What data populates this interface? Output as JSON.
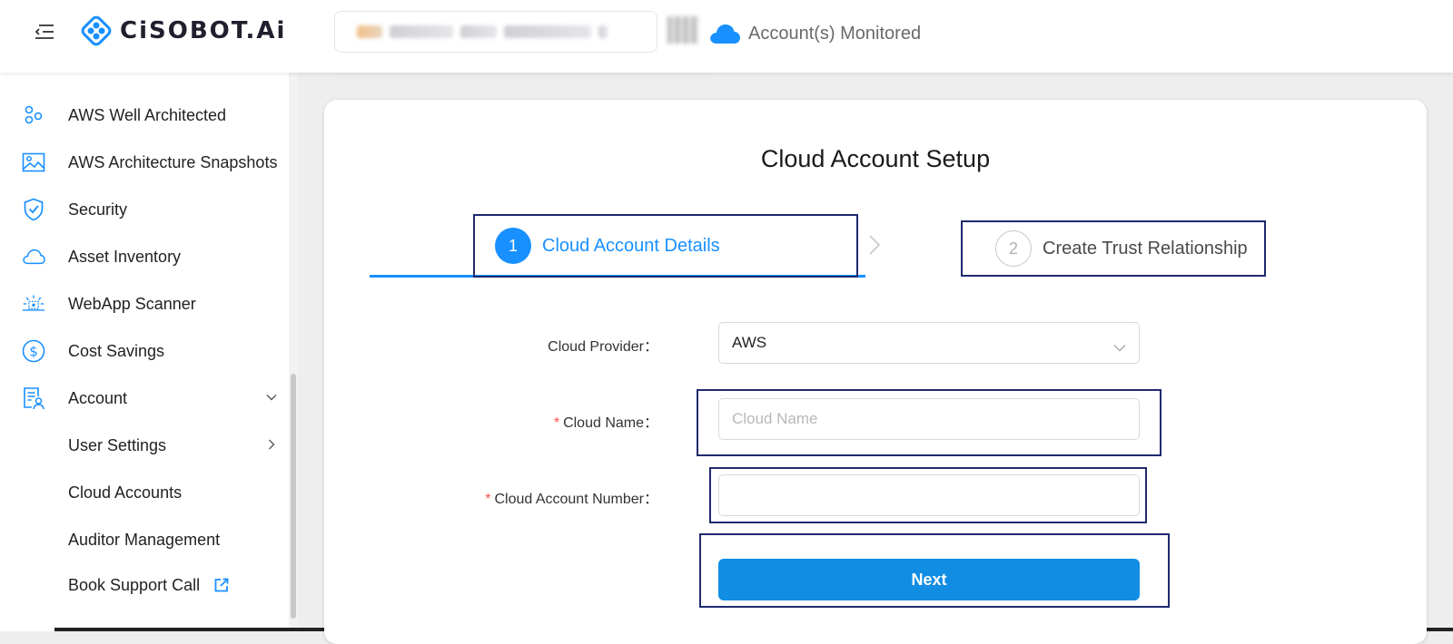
{
  "header": {
    "logo_text": "CiSOBOT.Ai",
    "monitored_label": "Account(s) Monitored"
  },
  "sidebar": {
    "items": [
      {
        "label": "AWS Well Architected",
        "icon": "aws-well-architected-icon"
      },
      {
        "label": "AWS Architecture Snapshots",
        "icon": "image-icon"
      },
      {
        "label": "Security",
        "icon": "shield-check-icon"
      },
      {
        "label": "Asset Inventory",
        "icon": "cloud-icon"
      },
      {
        "label": "WebApp Scanner",
        "icon": "scanner-icon"
      },
      {
        "label": "Cost Savings",
        "icon": "dollar-icon"
      },
      {
        "label": "Account",
        "icon": "account-icon"
      },
      {
        "label": "User Settings"
      },
      {
        "label": "Cloud Accounts"
      },
      {
        "label": "Auditor Management"
      },
      {
        "label": "Book Support Call",
        "icon": "external-link-icon"
      }
    ]
  },
  "main": {
    "title": "Cloud Account Setup",
    "steps": [
      {
        "number": "1",
        "label": "Cloud Account Details",
        "state": "active"
      },
      {
        "number": "2",
        "label": "Create Trust Relationship",
        "state": "pending"
      }
    ],
    "form": {
      "provider_label": "Cloud Provider：",
      "provider_value": "AWS",
      "name_label": "Cloud Name：",
      "name_placeholder": "Cloud Name",
      "name_value": "",
      "account_number_label": "Cloud Account Number：",
      "account_number_value": "",
      "required_mark": "*",
      "next_label": "Next"
    }
  },
  "colors": {
    "accent": "#1890ff",
    "button": "#118de3",
    "highlight_border": "#1f2a6e",
    "required": "#ff4d4f"
  }
}
